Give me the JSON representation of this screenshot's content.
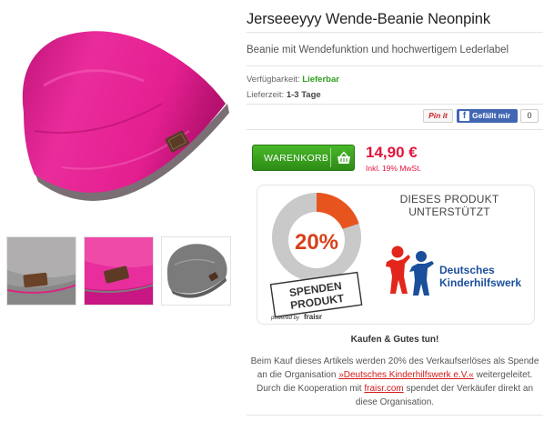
{
  "product": {
    "title": "Jerseeeyyy Wende-Beanie Neonpink",
    "subtitle": "Beanie mit Wendefunktion und hochwertigem Lederlabel",
    "availability_label": "Verfügbarkeit:",
    "availability_value": "Lieferbar",
    "delivery_label": "Lieferzeit:",
    "delivery_value": "1-3 Tage",
    "colors": {
      "main": "#e0208f",
      "lining": "#7a7a7a",
      "label": "#5a3b26"
    }
  },
  "images": {
    "main_icon": "pink-beanie-photo",
    "thumbnails": [
      {
        "icon": "grey-side-label-closeup"
      },
      {
        "icon": "pink-side-label-closeup"
      },
      {
        "icon": "grey-beanie-photo"
      }
    ]
  },
  "social": {
    "pinit_label": "Pin it",
    "fb_label": "Gefällt mir",
    "fb_count": "0"
  },
  "cart": {
    "button_label": "WARENKORB",
    "price": "14,90 €",
    "price_note": "Inkl. 19% MwSt."
  },
  "donation": {
    "badge_percent": "20%",
    "badge_line1": "SPENDEN",
    "badge_line2": "PRODUKT",
    "powered_label": "powered by",
    "powered_brand": "fraisr",
    "supports_line1": "DIESES PRODUKT",
    "supports_line2": "UNTERSTÜTZT",
    "org_line1": "Deutsches",
    "org_line2": "Kinderhilfswerk",
    "colors": {
      "accent": "#e8541d",
      "grey": "#c8c8c8",
      "org_blue": "#1a4f9c",
      "org_red": "#e2261c"
    }
  },
  "info": {
    "heading": "Kaufen & Gutes tun!",
    "text_part1": "Beim Kauf dieses Artikels werden 20% des Verkaufserlöses als Spende an die Organisation ",
    "org_link": "»Deutsches Kinderhilfswerk e.V.«",
    "text_part2": " weitergeleitet. Durch die Kooperation mit ",
    "fraisr_link": "fraisr.com",
    "text_part3": " spendet der Verkäufer direkt an diese Organisation."
  }
}
